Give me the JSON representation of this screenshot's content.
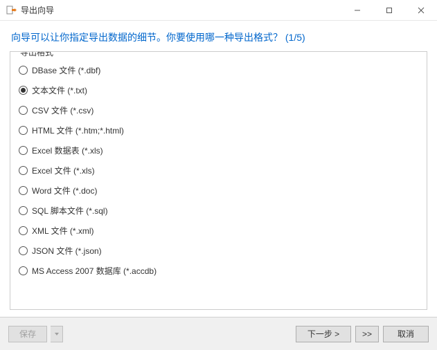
{
  "window": {
    "title": "导出向导"
  },
  "header": {
    "prompt": "向导可以让你指定导出数据的细节。你要使用哪一种导出格式？ (1/5)"
  },
  "fieldset": {
    "legend": "导出格式"
  },
  "formats": [
    {
      "label": "DBase 文件 (*.dbf)",
      "selected": false
    },
    {
      "label": "文本文件 (*.txt)",
      "selected": true
    },
    {
      "label": "CSV 文件 (*.csv)",
      "selected": false
    },
    {
      "label": "HTML 文件 (*.htm;*.html)",
      "selected": false
    },
    {
      "label": "Excel 数据表 (*.xls)",
      "selected": false
    },
    {
      "label": "Excel 文件 (*.xls)",
      "selected": false
    },
    {
      "label": "Word 文件 (*.doc)",
      "selected": false
    },
    {
      "label": "SQL 脚本文件 (*.sql)",
      "selected": false
    },
    {
      "label": "XML 文件 (*.xml)",
      "selected": false
    },
    {
      "label": "JSON 文件 (*.json)",
      "selected": false
    },
    {
      "label": "MS Access 2007 数据库 (*.accdb)",
      "selected": false
    }
  ],
  "footer": {
    "save": "保存",
    "next": "下一步 >",
    "forward": ">>",
    "cancel": "取消"
  }
}
